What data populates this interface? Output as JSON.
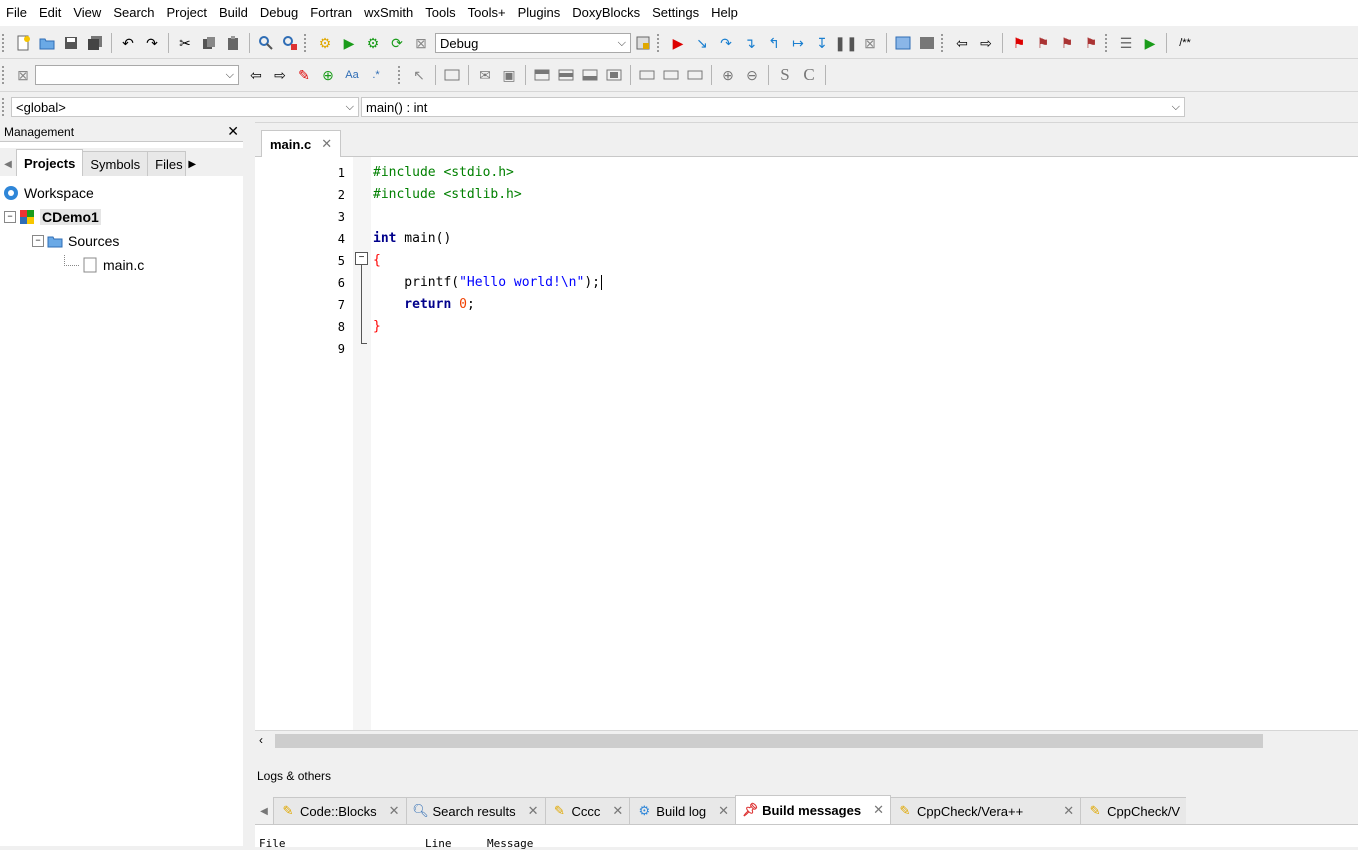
{
  "menu": [
    "File",
    "Edit",
    "View",
    "Search",
    "Project",
    "Build",
    "Debug",
    "Fortran",
    "wxSmith",
    "Tools",
    "Tools+",
    "Plugins",
    "DoxyBlocks",
    "Settings",
    "Help"
  ],
  "toolbar": {
    "build_target": "Debug",
    "doxy_comment": "/**"
  },
  "toolbar2": {
    "search_value": "",
    "text_s": "S",
    "text_c": "C",
    "regex": ".*"
  },
  "scope": {
    "left": "<global>",
    "right": "main() : int"
  },
  "management": {
    "title": "Management",
    "tabs": [
      "Projects",
      "Symbols",
      "Files"
    ],
    "tree": {
      "workspace": "Workspace",
      "project": "CDemo1",
      "folder": "Sources",
      "file": "main.c"
    }
  },
  "editor": {
    "tab": "main.c",
    "line_numbers": [
      "1",
      "2",
      "3",
      "4",
      "5",
      "6",
      "7",
      "8",
      "9"
    ],
    "lines": {
      "l1": "#include <stdio.h>",
      "l2": "#include <stdlib.h>",
      "l4a": "int",
      "l4b": " main()",
      "l5": "{",
      "l6a": "    printf(",
      "l6b": "\"Hello world!\\n\"",
      "l6c": ");",
      "l7a": "    return",
      "l7b": "0",
      "l7c": ";",
      "l8": "}"
    }
  },
  "logs": {
    "title": "Logs & others",
    "tabs": [
      "Code::Blocks",
      "Search results",
      "Cccc",
      "Build log",
      "Build messages",
      "CppCheck/Vera++",
      "CppCheck/V"
    ],
    "columns": [
      "File",
      "Line",
      "Message"
    ]
  }
}
